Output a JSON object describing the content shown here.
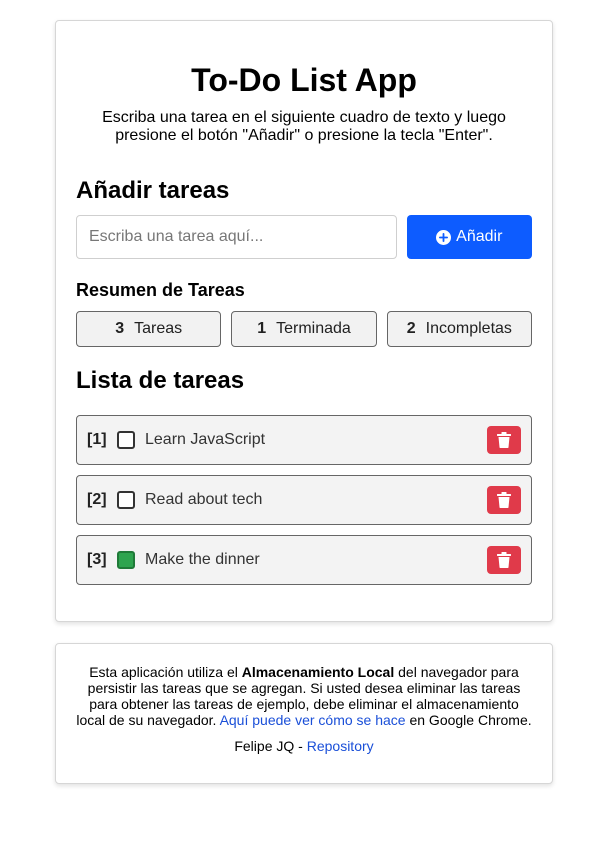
{
  "header": {
    "title": "To-Do List App",
    "subtitle": "Escriba una tarea en el siguiente cuadro de texto y luego presione el botón \"Añadir\" o presione la tecla \"Enter\"."
  },
  "add_section": {
    "heading": "Añadir tareas",
    "input_placeholder": "Escriba una tarea aquí...",
    "input_value": "",
    "button_label": "Añadir",
    "button_icon": "plus-circle-icon"
  },
  "summary": {
    "heading": "Resumen de Tareas",
    "stats": [
      {
        "count": "3",
        "label": "Tareas"
      },
      {
        "count": "1",
        "label": "Terminada"
      },
      {
        "count": "2",
        "label": "Incompletas"
      }
    ]
  },
  "list": {
    "heading": "Lista de tareas",
    "tasks": [
      {
        "index": "[1]",
        "text": "Learn JavaScript",
        "done": false
      },
      {
        "index": "[2]",
        "text": "Read about tech",
        "done": false
      },
      {
        "index": "[3]",
        "text": "Make the dinner",
        "done": true
      }
    ],
    "delete_icon": "trash-icon"
  },
  "footer": {
    "text_before": "Esta aplicación utiliza el ",
    "text_bold": "Almacenamiento Local",
    "text_middle": " del navegador para persistir las tareas que se agregan. Si usted desea eliminar las tareas para obtener las tareas de ejemplo, debe eliminar el almacenamiento local de su navegador. ",
    "link_text": "Aquí puede ver cómo se hace",
    "text_after": " en Google Chrome.",
    "author": "Felipe JQ",
    "separator": " - ",
    "repo_link": "Repository"
  },
  "colors": {
    "accent": "#0d5cff",
    "danger": "#e03a4a",
    "done": "#2ea44f",
    "link": "#1a4fd8"
  }
}
